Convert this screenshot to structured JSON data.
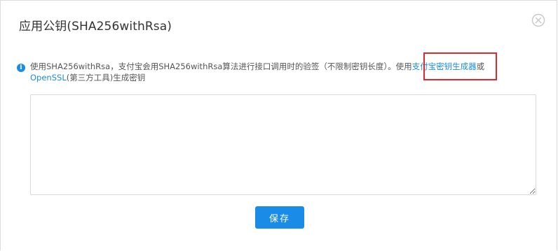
{
  "dialog": {
    "title": "应用公钥(SHA256withRsa)",
    "close_icon": "close-circle-icon"
  },
  "notice": {
    "icon": "info-icon",
    "text_before": "使用SHA256withRsa，支付宝会用SHA256withRsa算法进行接口调用时的验签（不限制密钥长度）。使用",
    "link_generator": "支付宝密钥生成器",
    "text_or": "或",
    "link_openssl": "OpenSSL",
    "text_after": "(第三方工具)生成密钥"
  },
  "key_input": {
    "value": "",
    "placeholder": ""
  },
  "save_button": {
    "label": "保存"
  },
  "colors": {
    "accent": "#1a8ce8",
    "highlight": "#e0282f"
  }
}
